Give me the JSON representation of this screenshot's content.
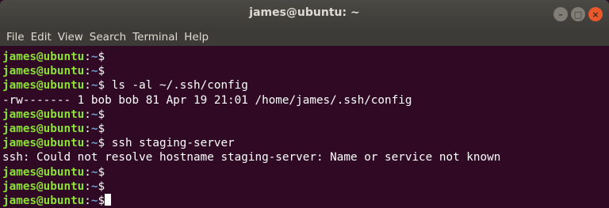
{
  "window": {
    "title": "james@ubuntu: ~",
    "controls": {
      "minimize": "–",
      "maximize": "□",
      "close": "×"
    }
  },
  "menu": [
    "File",
    "Edit",
    "View",
    "Search",
    "Terminal",
    "Help"
  ],
  "terminal": {
    "prompt_user": "james@ubuntu",
    "prompt_sep": ":",
    "prompt_path": "~",
    "prompt_symbol": "$",
    "lines": [
      {
        "type": "prompt",
        "cmd": ""
      },
      {
        "type": "prompt",
        "cmd": ""
      },
      {
        "type": "prompt",
        "cmd": " ls -al ~/.ssh/config"
      },
      {
        "type": "output",
        "text": "-rw------- 1 bob bob 81 Apr 19 21:01 /home/james/.ssh/config"
      },
      {
        "type": "prompt",
        "cmd": ""
      },
      {
        "type": "prompt",
        "cmd": ""
      },
      {
        "type": "prompt",
        "cmd": " ssh staging-server"
      },
      {
        "type": "output",
        "text": "ssh: Could not resolve hostname staging-server: Name or service not known"
      },
      {
        "type": "prompt",
        "cmd": ""
      },
      {
        "type": "prompt",
        "cmd": ""
      },
      {
        "type": "prompt",
        "cmd": ""
      }
    ]
  },
  "colors": {
    "background": "#300a24",
    "prompt_user": "#8ae234",
    "prompt_path": "#729fcf",
    "text": "#ffffff"
  }
}
